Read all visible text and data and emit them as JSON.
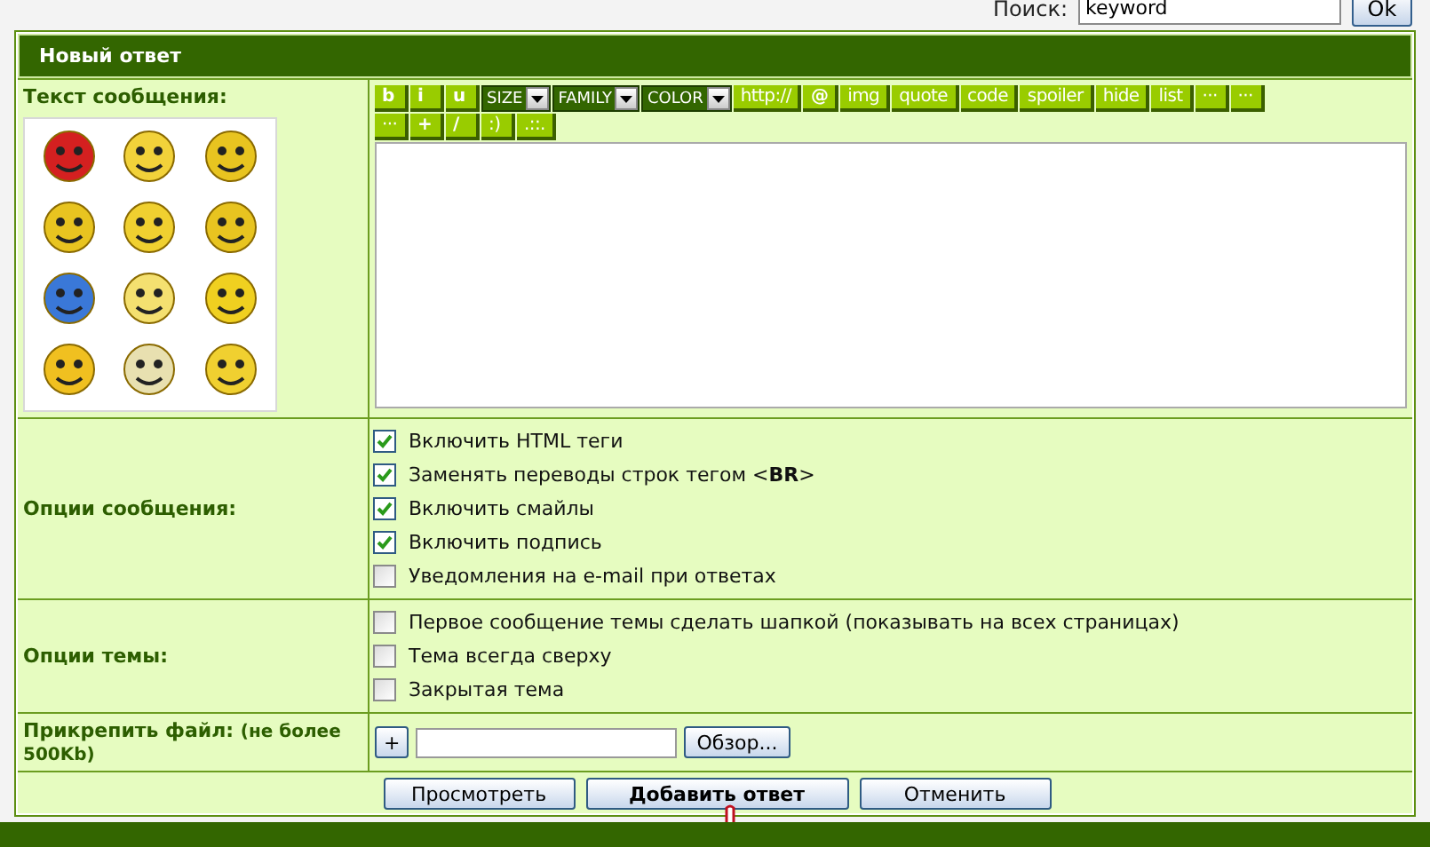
{
  "search": {
    "label": "Поиск:",
    "value": "keyword",
    "button": "Ok"
  },
  "form": {
    "title": "Новый ответ",
    "message": {
      "label": "Текст сообщения:",
      "toolbar_rows": [
        [
          {
            "kind": "button",
            "label": "b"
          },
          {
            "kind": "button",
            "label": "i"
          },
          {
            "kind": "button",
            "label": "u"
          },
          {
            "kind": "select",
            "label": "SIZE"
          },
          {
            "kind": "select",
            "label": "FAMILY"
          },
          {
            "kind": "select",
            "label": "COLOR"
          },
          {
            "kind": "button",
            "label": "http://"
          },
          {
            "kind": "button",
            "label": "@"
          },
          {
            "kind": "button",
            "label": "img"
          },
          {
            "kind": "button",
            "label": "quote"
          },
          {
            "kind": "button",
            "label": "code"
          },
          {
            "kind": "button",
            "label": "spoiler"
          },
          {
            "kind": "button",
            "label": "hide"
          },
          {
            "kind": "button",
            "label": "list"
          },
          {
            "kind": "button",
            "label": "···"
          },
          {
            "kind": "button",
            "label": "···"
          }
        ],
        [
          {
            "kind": "button",
            "label": "···"
          },
          {
            "kind": "button",
            "label": "+"
          },
          {
            "kind": "button",
            "label": "/"
          },
          {
            "kind": "button",
            "label": ":)"
          },
          {
            "kind": "button",
            "label": ".::."
          }
        ]
      ]
    },
    "post_options": {
      "label": "Опции сообщения:",
      "items": [
        {
          "label": "Включить HTML теги",
          "checked": true
        },
        {
          "label": "Заменять переводы строк тегом <**BR**>",
          "checked": true
        },
        {
          "label": "Включить смайлы",
          "checked": true
        },
        {
          "label": "Включить подпись",
          "checked": true
        },
        {
          "label": "Уведомления на e-mail при ответах",
          "checked": false
        }
      ]
    },
    "topic_options": {
      "label": "Опции темы:",
      "items": [
        {
          "label": "Первое сообщение темы сделать шапкой (показывать на всех страницах)",
          "checked": false
        },
        {
          "label": "Тема всегда сверху",
          "checked": false
        },
        {
          "label": "Закрытая тема",
          "checked": false
        }
      ]
    },
    "attach": {
      "label": "Прикрепить файл:",
      "note": "(не более 500Kb)",
      "add_button": "+",
      "browse_button": "Обзор..."
    },
    "buttons": [
      {
        "label": "Просмотреть",
        "primary": false
      },
      {
        "label": "Добавить ответ",
        "primary": true
      },
      {
        "label": "Отменить",
        "primary": false
      }
    ]
  }
}
